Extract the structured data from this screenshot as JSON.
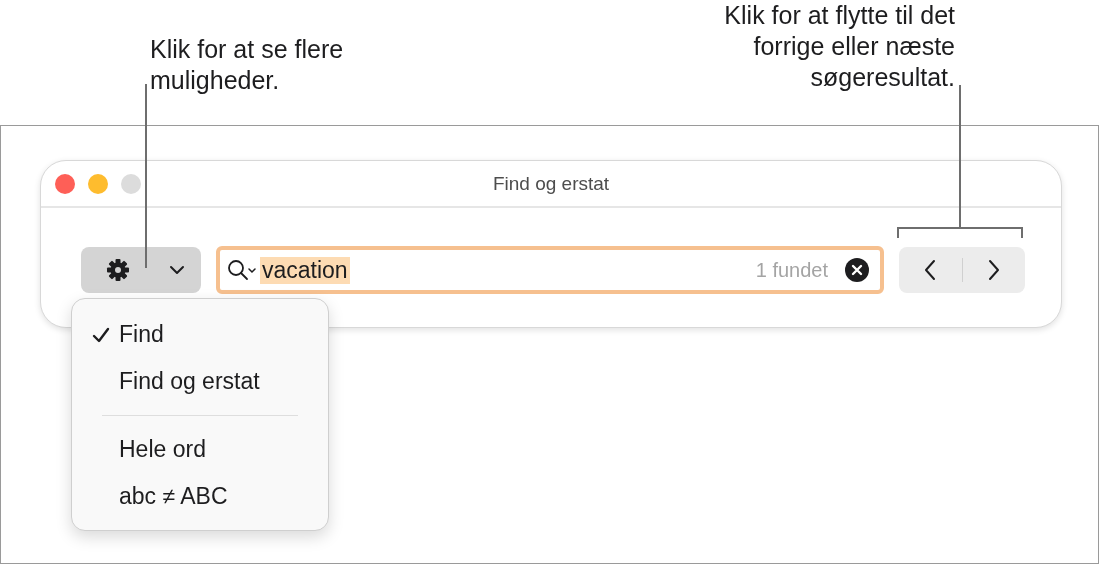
{
  "callouts": [
    {
      "kind": "left",
      "lines": [
        "Klik for at se flere",
        "muligheder."
      ]
    },
    {
      "kind": "right",
      "lines": [
        "Klik for at flytte til det",
        "forrige eller næste",
        "søgeresultat."
      ]
    }
  ],
  "window": {
    "title": "Find og erstat"
  },
  "search": {
    "value": "vacation",
    "highlighted": true,
    "result_count": "1 fundet"
  },
  "menu": {
    "items": [
      {
        "kind": "option",
        "label": "Find",
        "checked": true
      },
      {
        "kind": "option",
        "label": "Find og erstat",
        "checked": false
      },
      {
        "kind": "separator"
      },
      {
        "kind": "option",
        "label": "Hele ord",
        "checked": false
      },
      {
        "kind": "option",
        "label": "abc ≠ ABC",
        "checked": false
      }
    ]
  }
}
